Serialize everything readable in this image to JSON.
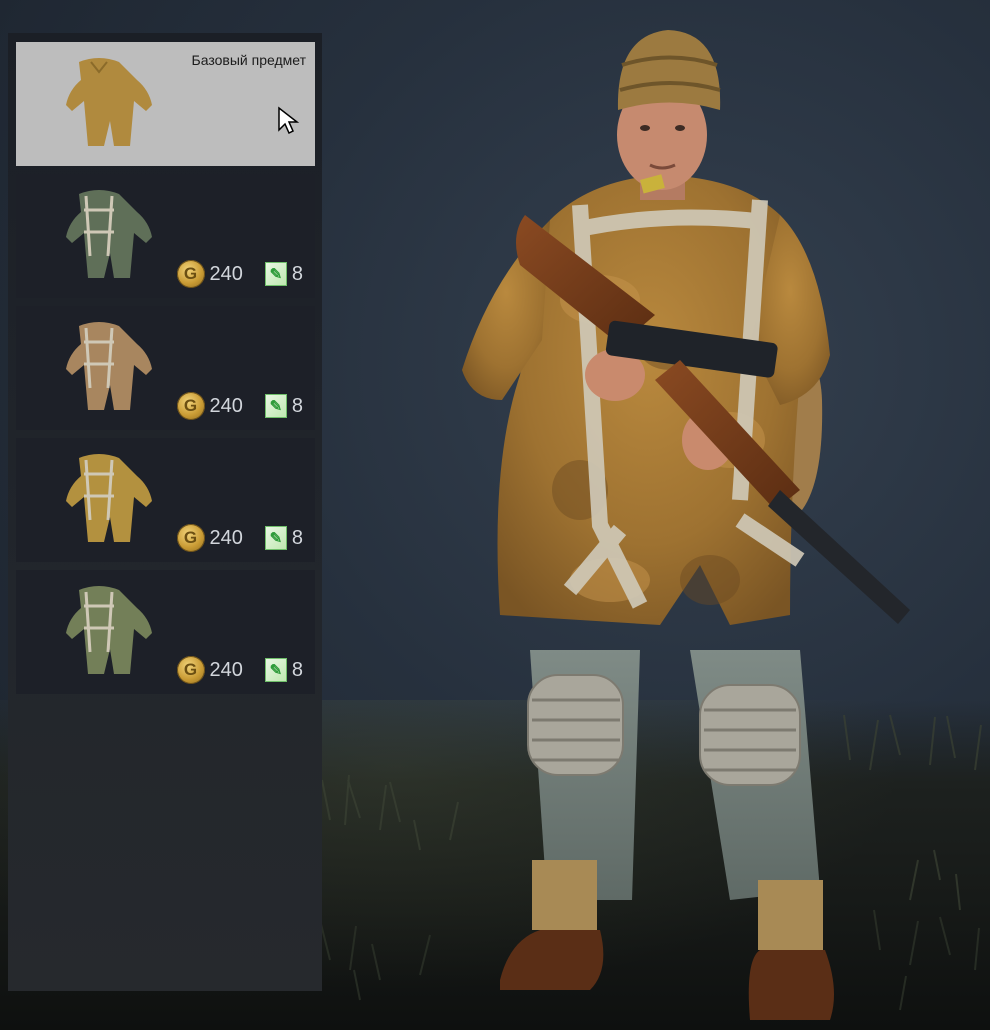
{
  "panel": {
    "items": [
      {
        "name": "uniform-base",
        "label": "Базовый предмет",
        "selected": true,
        "color": "#b08a3e",
        "strap": false
      },
      {
        "name": "uniform-green-camo",
        "gold": "240",
        "tickets": "8",
        "selected": false,
        "color": "#5f6f58",
        "strap": true
      },
      {
        "name": "uniform-sand-camo",
        "gold": "240",
        "tickets": "8",
        "selected": false,
        "color": "#a8865f",
        "strap": true
      },
      {
        "name": "uniform-yellow-camo",
        "gold": "240",
        "tickets": "8",
        "selected": false,
        "color": "#b3913f",
        "strap": true
      },
      {
        "name": "uniform-olive-camo",
        "gold": "240",
        "tickets": "8",
        "selected": false,
        "color": "#737f58",
        "strap": true
      }
    ]
  },
  "icons": {
    "gold": "gold-coin-icon",
    "ticket": "ticket-icon",
    "cursor": "mouse-cursor-icon"
  },
  "colors": {
    "selected_bg": "#bdbdbd",
    "item_bg": "#1d2028",
    "gold": "#c99b34",
    "ticket": "#2e9b3a"
  }
}
